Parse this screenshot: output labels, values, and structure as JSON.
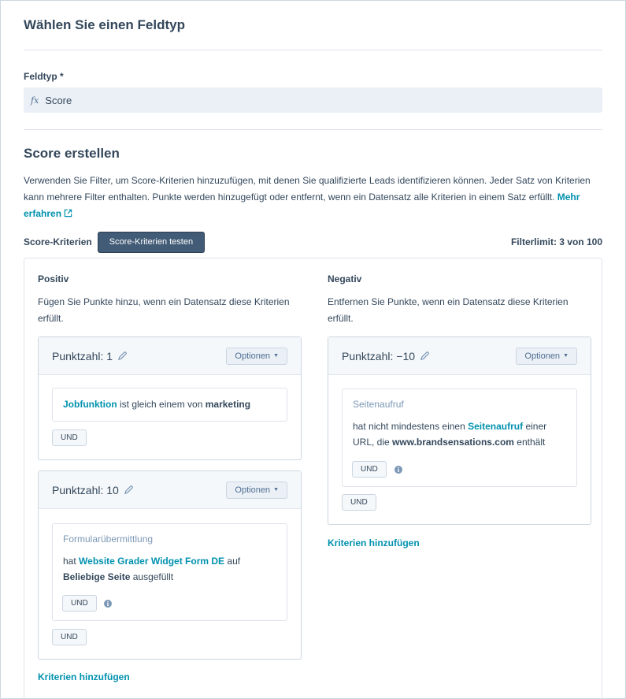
{
  "header": {
    "title": "Wählen Sie einen Feldtyp"
  },
  "field_type": {
    "label": "Feldtyp *",
    "icon": "fx-formula-icon",
    "value": "Score"
  },
  "score": {
    "title": "Score erstellen",
    "description": "Verwenden Sie Filter, um Score-Kriterien hinzuzufügen, mit denen Sie qualifizierte Leads identifizieren können. Jeder Satz von Kriterien kann mehrere Filter enthalten. Punkte werden hinzugefügt oder entfernt, wenn ein Datensatz alle Kriterien in einem Satz erfüllt.",
    "learn_more": "Mehr erfahren",
    "criteria_label": "Score-Kriterien",
    "test_button": "Score-Kriterien testen",
    "filter_limit": "Filterlimit: 3 von 100"
  },
  "positive": {
    "title": "Positiv",
    "description": "Fügen Sie Punkte hinzu, wenn ein Datensatz diese Kriterien erfüllt.",
    "card1": {
      "points": "Punktzahl: 1",
      "options": "Optionen",
      "filter": {
        "property": "Jobfunktion",
        "op": "ist gleich einem von",
        "value": "marketing"
      },
      "and": "UND"
    },
    "card2": {
      "points": "Punktzahl: 10",
      "options": "Optionen",
      "filter": {
        "type": "Formularübermittlung",
        "pre": "hat",
        "form": "Website Grader Widget Form DE",
        "mid": "auf",
        "page": "Beliebige Seite",
        "post": "ausgefüllt"
      },
      "inner_and": "UND",
      "and": "UND"
    },
    "add_criteria": "Kriterien hinzufügen"
  },
  "negative": {
    "title": "Negativ",
    "description": "Entfernen Sie Punkte, wenn ein Datensatz diese Kriterien erfüllt.",
    "card1": {
      "points": "Punktzahl: −10",
      "options": "Optionen",
      "filter": {
        "type": "Seitenaufruf",
        "pre": "hat nicht mindestens einen",
        "prop": "Seitenaufruf",
        "mid": "einer URL, die",
        "url": "www.brandsensations.com",
        "post": "enthält"
      },
      "inner_and": "UND",
      "and": "UND"
    },
    "add_criteria": "Kriterien hinzufügen"
  },
  "colors": {
    "accent": "#0091ae",
    "text": "#33475b",
    "button_dark": "#425b76"
  }
}
